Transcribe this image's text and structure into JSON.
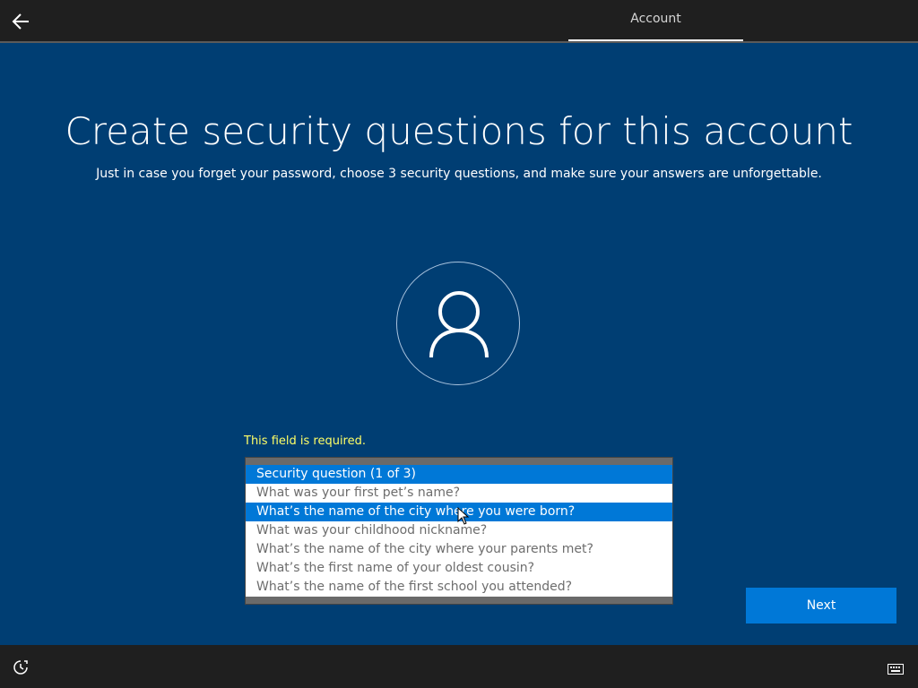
{
  "topbar": {
    "back_icon": "arrow-left-icon",
    "tab_label": "Account"
  },
  "main": {
    "title": "Create security questions for this account",
    "subtitle": "Just in case you forget your password, choose 3 security questions, and make sure your answers are unforgettable.",
    "avatar_icon": "user-icon",
    "error": "This field is required."
  },
  "dropdown": {
    "options": [
      "Security question (1 of 3)",
      "What was your first pet’s name?",
      "What’s the name of the city where you were born?",
      "What was your childhood nickname?",
      "What’s the name of the city where your parents met?",
      "What’s the first name of your oldest cousin?",
      "What’s the name of the first school you attended?"
    ],
    "selected_index": 0,
    "hover_index": 2
  },
  "next_button": {
    "label": "Next"
  },
  "bottombar": {
    "left_icon": "ease-of-access-icon",
    "right_icon": "keyboard-icon"
  },
  "colors": {
    "background": "#003e73",
    "accent": "#0078d7",
    "error": "#ffff66",
    "bar": "#1f1f1f"
  }
}
